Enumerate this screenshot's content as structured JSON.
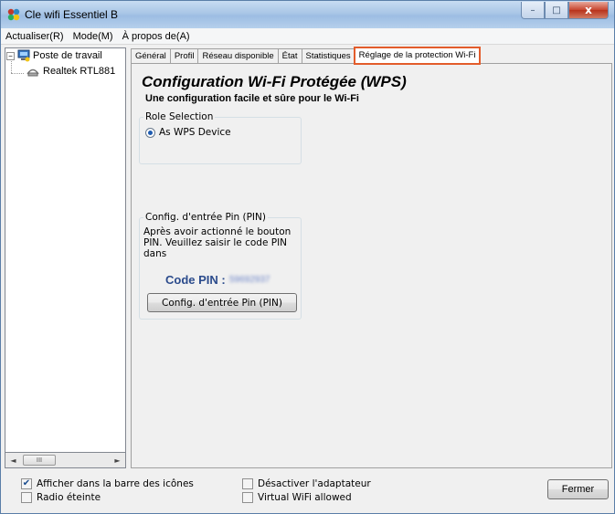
{
  "window": {
    "title": "Cle wifi Essentiel B",
    "minimize_glyph": "–",
    "maximize_glyph": "□",
    "close_glyph": "x"
  },
  "menu": {
    "items": [
      "Actualiser(R)",
      "Mode(M)",
      "À propos de(A)"
    ]
  },
  "tree": {
    "root": {
      "expander": "−",
      "label": "Poste de travail",
      "icon": "computer-icon"
    },
    "child": {
      "label": "Realtek RTL881",
      "icon": "network-adapter-icon"
    },
    "scroll_thumb": "III",
    "scroll_left": "◄",
    "scroll_right": "►"
  },
  "tabs": [
    {
      "label": "Général"
    },
    {
      "label": "Profil"
    },
    {
      "label": "Réseau disponible"
    },
    {
      "label": "État"
    },
    {
      "label": "Statistiques"
    },
    {
      "label": "Réglage de la protection Wi-Fi",
      "active": true
    }
  ],
  "wps": {
    "title": "Configuration Wi-Fi Protégée (WPS)",
    "subtitle": "Une configuration facile et sûre pour le Wi-Fi",
    "role_group": {
      "legend": "Role Selection",
      "option": "As WPS Device",
      "selected": true
    },
    "pin_group": {
      "legend": "Config. d'entrée Pin (PIN)",
      "desc_line1": "Après avoir actionné le bouton",
      "desc_line2": "PIN. Veuillez saisir le code PIN dans",
      "code_label": "Code PIN :",
      "code_value": "59692937",
      "button": "Config. d'entrée Pin (PIN)"
    }
  },
  "footer": {
    "show_in_tray": {
      "label": "Afficher dans la barre des icônes",
      "checked": true
    },
    "radio_off": {
      "label": "Radio éteinte",
      "checked": false
    },
    "disable_adapter": {
      "label": "Désactiver l'adaptateur",
      "checked": false
    },
    "virtual_wifi": {
      "label": "Virtual WiFi allowed",
      "checked": false
    },
    "close_button": "Fermer",
    "check_glyph": "✔"
  },
  "colors": {
    "active_tab_outline": "#e35c2b",
    "code_pin_label": "#2b4b8c"
  }
}
